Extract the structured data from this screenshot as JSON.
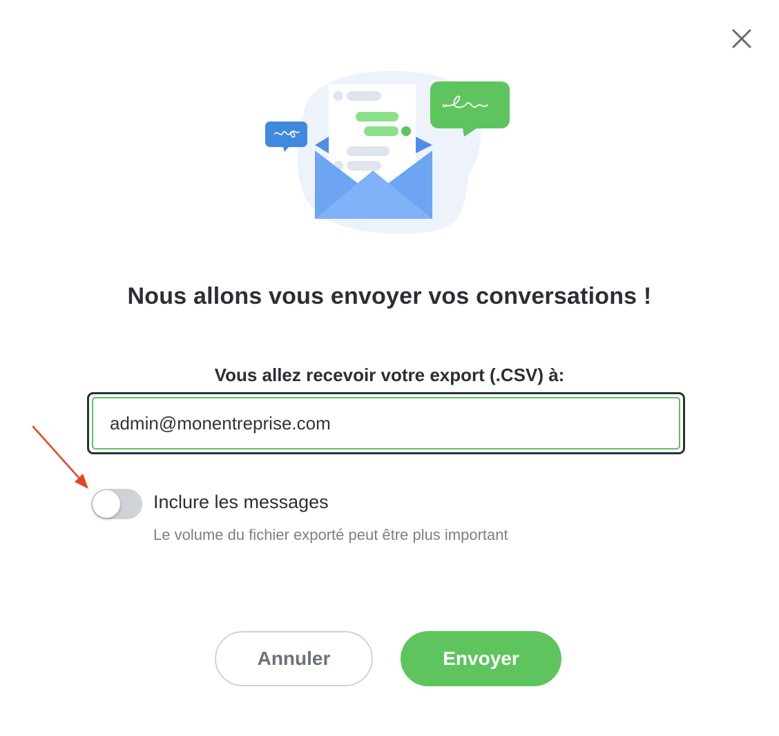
{
  "dialog": {
    "title": "Nous allons vous envoyer vos conversations !",
    "export_label": "Vous allez recevoir votre export (.CSV) à:",
    "email_value": "admin@monentreprise.com",
    "include_messages_label": "Inclure les messages",
    "include_messages_help": "Le volume du fichier exporté peut être plus important",
    "include_messages_on": false,
    "cancel_label": "Annuler",
    "send_label": "Envoyer"
  },
  "icons": {
    "close": "close-icon",
    "illustration": "envelope-chat-illustration",
    "annotation": "red-arrow"
  },
  "colors": {
    "accent_green": "#5ec55e",
    "focus_border": "#2c2f33",
    "toggle_off": "#cfd2d7",
    "annotation_red": "#e8412a"
  }
}
